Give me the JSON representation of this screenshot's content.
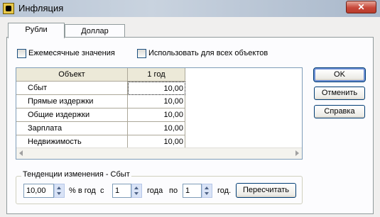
{
  "window": {
    "title": "Инфляция",
    "close_label": "✕"
  },
  "tabs": [
    {
      "label": "Рубли",
      "active": true
    },
    {
      "label": "Доллар",
      "active": false
    }
  ],
  "options": {
    "monthly_label": "Ежемесячные значения",
    "all_objects_label": "Использовать для всех объектов"
  },
  "grid": {
    "col_object": "Объект",
    "col_year": "1 год",
    "rows": [
      {
        "name": "Сбыт",
        "value": "10,00"
      },
      {
        "name": "Прямые издержки",
        "value": "10,00"
      },
      {
        "name": "Общие издержки",
        "value": "10,00"
      },
      {
        "name": "Зарплата",
        "value": "10,00"
      },
      {
        "name": "Недвижимость",
        "value": "10,00"
      }
    ]
  },
  "buttons": {
    "ok": "OK",
    "cancel": "Отменить",
    "help": "Справка",
    "recalc": "Пересчитать"
  },
  "trend": {
    "caption": "Тенденции изменения - Сбыт",
    "percent_value": "10,00",
    "percent_label": "% в год",
    "from_label": "с",
    "from_value": "1",
    "year_label": "года",
    "to_label": "по",
    "to_value": "1",
    "year_end_label": "год."
  }
}
